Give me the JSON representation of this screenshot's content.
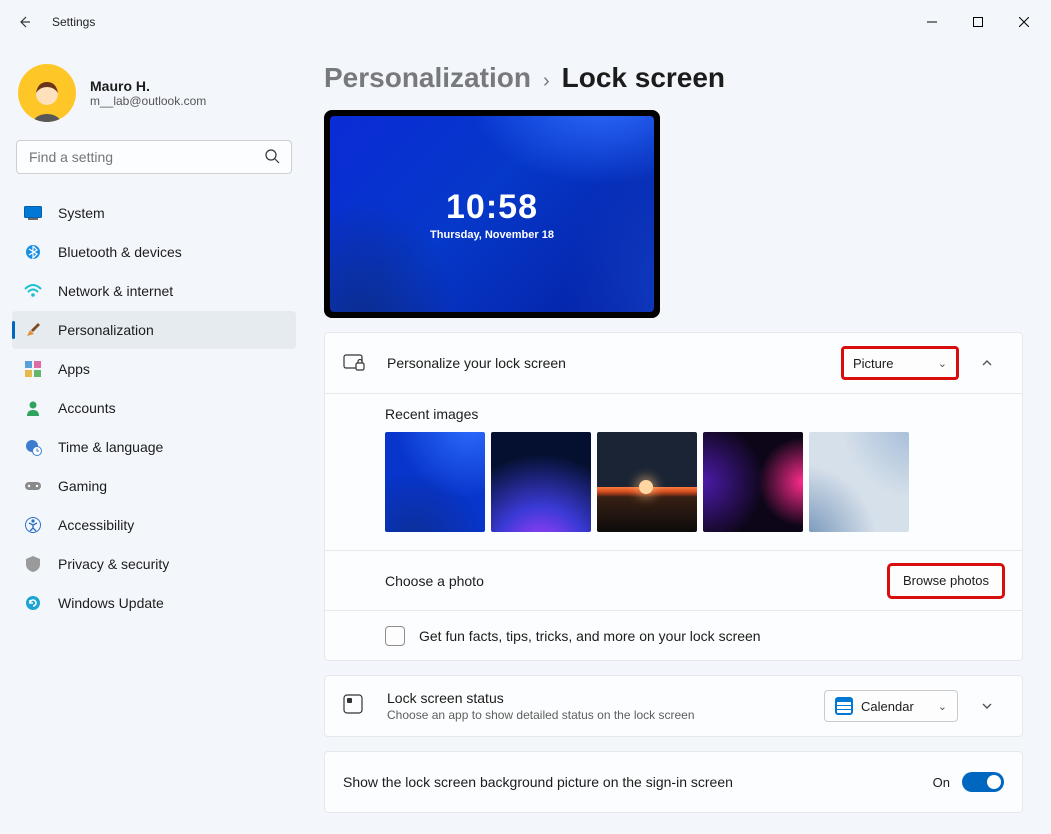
{
  "window": {
    "title": "Settings"
  },
  "profile": {
    "name": "Mauro H.",
    "email": "m__lab@outlook.com"
  },
  "search": {
    "placeholder": "Find a setting"
  },
  "sidebar": {
    "items": [
      {
        "label": "System"
      },
      {
        "label": "Bluetooth & devices"
      },
      {
        "label": "Network & internet"
      },
      {
        "label": "Personalization"
      },
      {
        "label": "Apps"
      },
      {
        "label": "Accounts"
      },
      {
        "label": "Time & language"
      },
      {
        "label": "Gaming"
      },
      {
        "label": "Accessibility"
      },
      {
        "label": "Privacy & security"
      },
      {
        "label": "Windows Update"
      }
    ],
    "active_index": 3
  },
  "breadcrumb": {
    "root": "Personalization",
    "current": "Lock screen"
  },
  "preview": {
    "time": "10:58",
    "date": "Thursday, November 18"
  },
  "personalize": {
    "title": "Personalize your lock screen",
    "select_value": "Picture",
    "recent_label": "Recent images",
    "choose_label": "Choose a photo",
    "browse_label": "Browse photos",
    "fun_label": "Get fun facts, tips, tricks, and more on your lock screen",
    "fun_checked": false
  },
  "status": {
    "title": "Lock screen status",
    "subtitle": "Choose an app to show detailed status on the lock screen",
    "select_value": "Calendar"
  },
  "signin": {
    "label": "Show the lock screen background picture on the sign-in screen",
    "state_text": "On"
  }
}
